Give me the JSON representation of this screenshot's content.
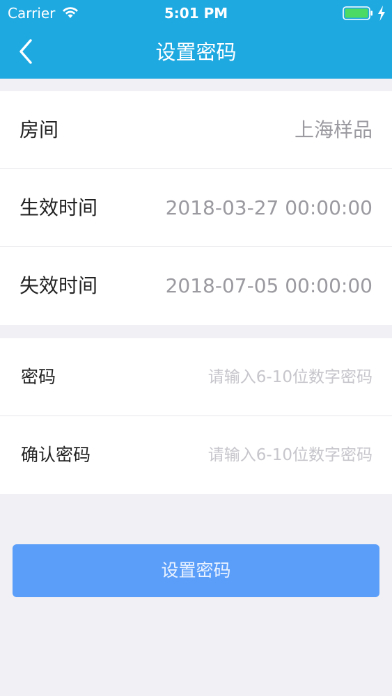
{
  "status_bar": {
    "carrier": "Carrier",
    "time": "5:01 PM"
  },
  "nav": {
    "title": "设置密码",
    "back_icon": "chevron-left-icon"
  },
  "details": {
    "room_label": "房间",
    "room_value": "上海样品",
    "effective_label": "生效时间",
    "effective_value": "2018-03-27 00:00:00",
    "expiry_label": "失效时间",
    "expiry_value": "2018-07-05 00:00:00"
  },
  "password_form": {
    "password_label": "密码",
    "password_placeholder": "请输入6-10位数字密码",
    "password_value": "",
    "confirm_label": "确认密码",
    "confirm_placeholder": "请输入6-10位数字密码",
    "confirm_value": ""
  },
  "submit_label": "设置密码",
  "colors": {
    "header": "#1fa9e1",
    "button": "#5b9ef9",
    "background": "#f0f0f5",
    "battery": "#4cd964"
  }
}
